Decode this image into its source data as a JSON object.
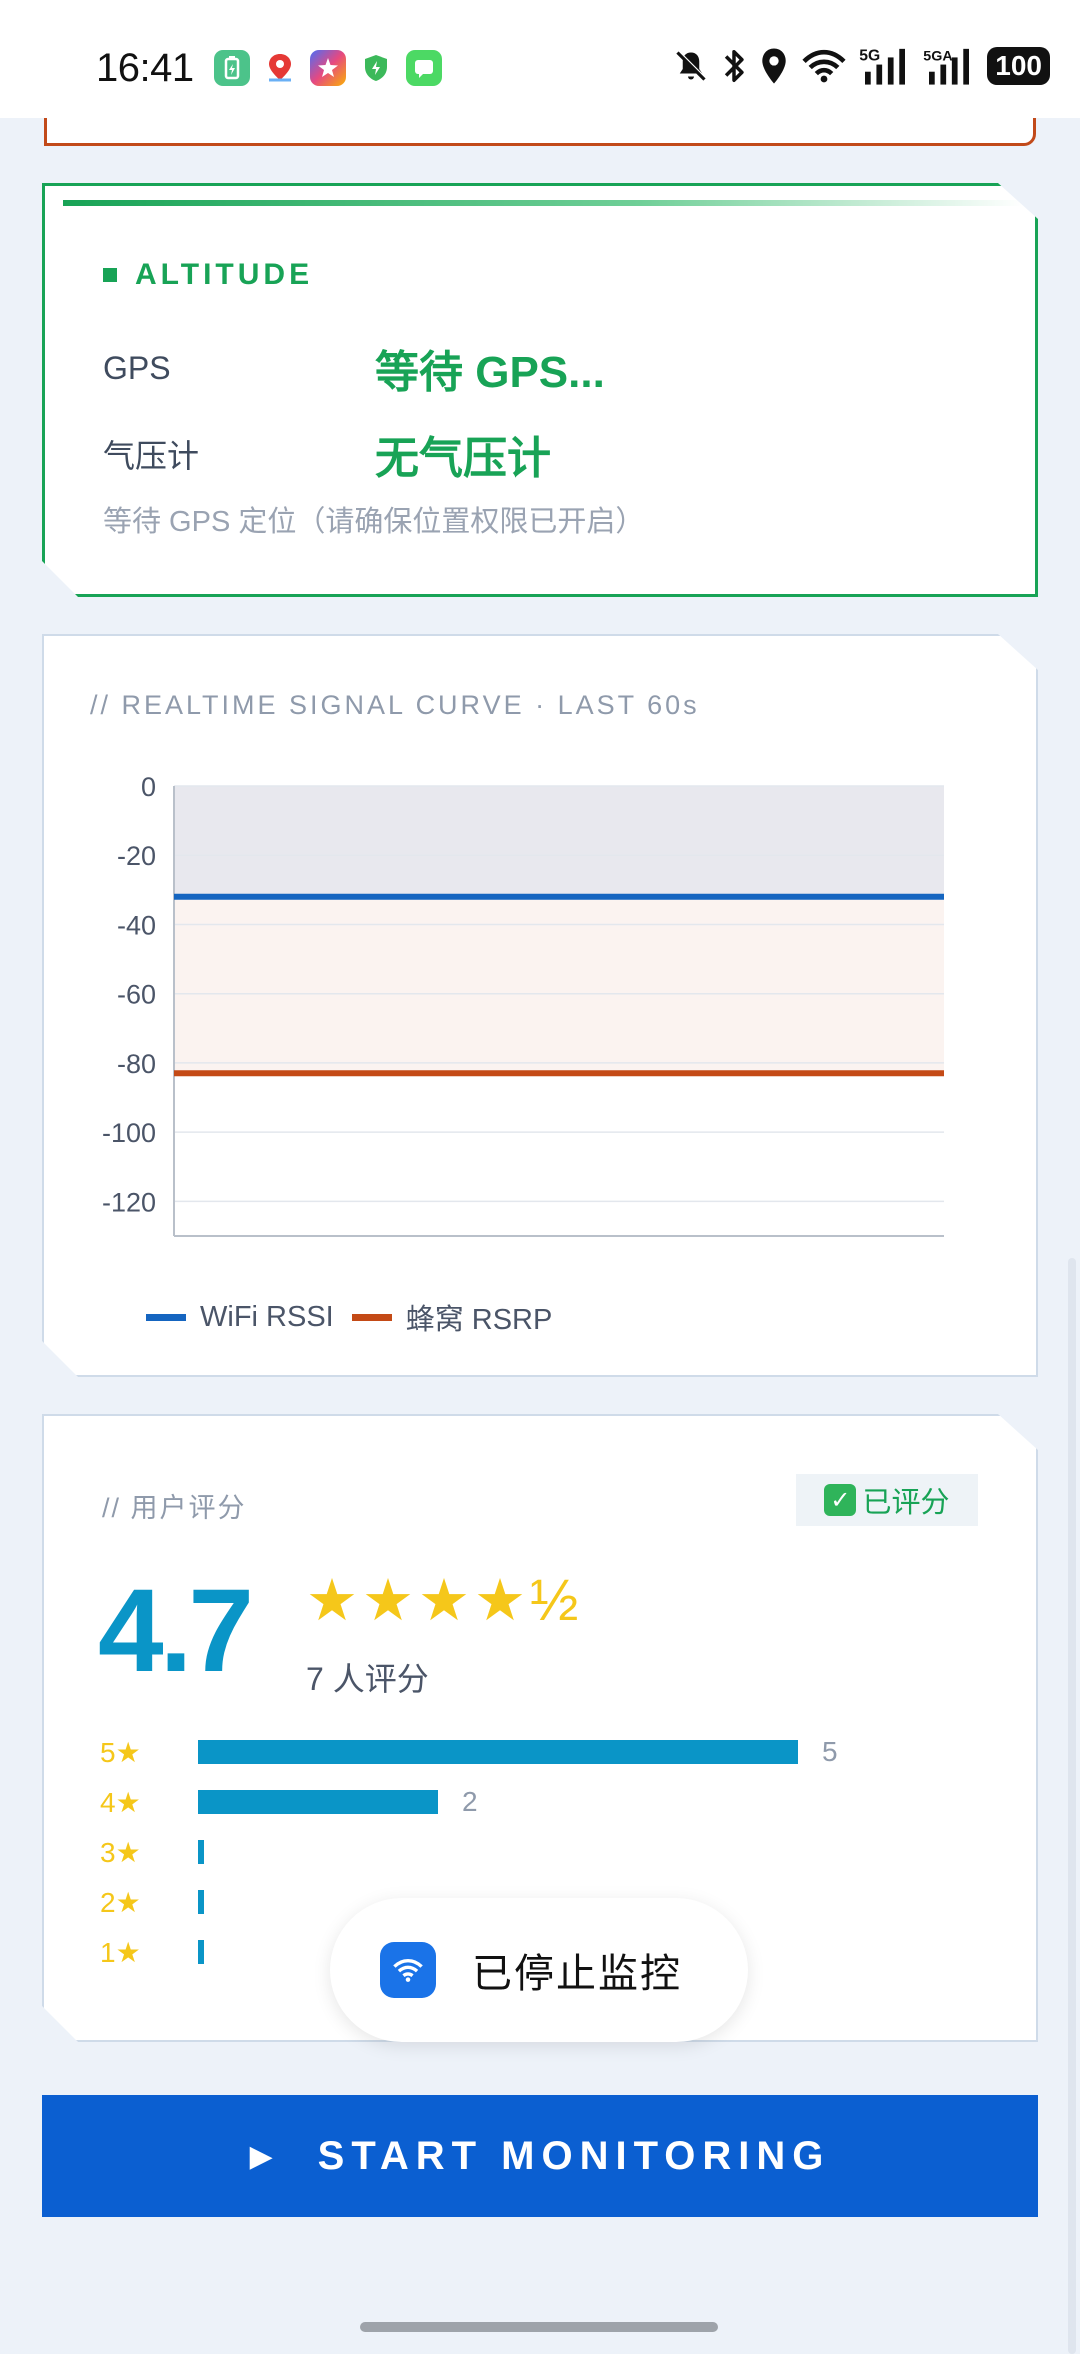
{
  "status_bar": {
    "time": "16:41",
    "battery": "100",
    "net1": "5G",
    "net2": "5GA",
    "icons_right": [
      "bell-off-icon",
      "bluetooth-icon",
      "location-icon",
      "wifi-icon",
      "signal-5g-icon",
      "signal-5ga-icon",
      "battery-icon"
    ]
  },
  "altitude": {
    "title": "ALTITUDE",
    "gps_label": "GPS",
    "gps_value": "等待 GPS...",
    "baro_label": "气压计",
    "baro_value": "无气压计",
    "note": "等待 GPS 定位（请确保位置权限已开启）"
  },
  "signal_chart": {
    "tag": "// REALTIME SIGNAL CURVE · LAST 60s",
    "legend": [
      "WiFi RSSI",
      "蜂窝 RSRP"
    ]
  },
  "chart_data": {
    "type": "line",
    "title": "// REALTIME SIGNAL CURVE · LAST 60s",
    "xlabel": "",
    "ylabel": "",
    "ylim": [
      -130,
      0
    ],
    "yticks": [
      "0",
      "-20",
      "-40",
      "-60",
      "-80",
      "-100",
      "-120"
    ],
    "grid": true,
    "legend_position": "bottom",
    "series": [
      {
        "name": "WiFi RSSI",
        "color": "#1565c0",
        "values": [
          -32,
          -32
        ]
      },
      {
        "name": "蜂窝 RSRP",
        "color": "#c44a16",
        "values": [
          -83,
          -83
        ]
      }
    ],
    "bands": [
      {
        "from": 0,
        "to": -32,
        "color": "#e8e8ee"
      },
      {
        "from": -32,
        "to": -83,
        "color": "#fbf3f0"
      }
    ]
  },
  "rating": {
    "tag": "// 用户评分",
    "badge": "已评分",
    "score": "4.7",
    "stars": "★★★★½",
    "count_text": "7 人评分",
    "distribution": [
      {
        "label": "5★",
        "count": 5,
        "count_text": "5"
      },
      {
        "label": "4★",
        "count": 2,
        "count_text": "2"
      },
      {
        "label": "3★",
        "count": 0,
        "count_text": ""
      },
      {
        "label": "2★",
        "count": 0,
        "count_text": ""
      },
      {
        "label": "1★",
        "count": 0,
        "count_text": ""
      }
    ]
  },
  "toast": {
    "text": "已停止监控"
  },
  "actions": {
    "start_label": "START MONITORING"
  },
  "colors": {
    "accent_green": "#18a356",
    "accent_blue": "#0a95c7",
    "button_blue": "#0b5fd1",
    "star_yellow": "#f5c71a"
  }
}
